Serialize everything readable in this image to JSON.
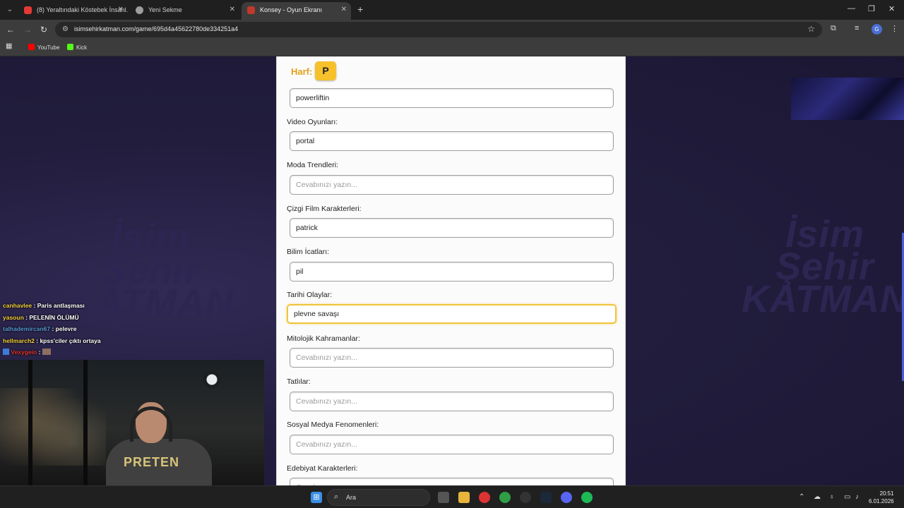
{
  "browser": {
    "tabs": [
      {
        "title": "(8) Yeraltındaki Köstebek İnsanl...",
        "favicon_color": "#e53935"
      },
      {
        "title": "Yeni Sekme",
        "favicon_color": "#9e9e9e"
      },
      {
        "title": "Konsey - Oyun Ekranı",
        "favicon_color": "#c0392b",
        "active": true
      }
    ],
    "url": "isimsehirkatman.com/game/695d4a45622780de334251a4",
    "bookmarks": [
      {
        "label": "YouTube",
        "color": "#ff0000"
      },
      {
        "label": "Kick",
        "color": "#53fc18"
      }
    ],
    "profile_initial": "G"
  },
  "game": {
    "letter_label": "Harf:",
    "letter": "P",
    "placeholder": "Cevabınızı yazın...",
    "fields": [
      {
        "label": "",
        "value": "powerliftin"
      },
      {
        "label": "Video Oyunları:",
        "value": "portal"
      },
      {
        "label": "Moda Trendleri:",
        "value": ""
      },
      {
        "label": "Çizgi Film Karakterleri:",
        "value": "patrick"
      },
      {
        "label": "Bilim İcatları:",
        "value": "pil"
      },
      {
        "label": "Tarihi Olaylar:",
        "value": "plevne savaşı",
        "focused": true
      },
      {
        "label": "Mitolojik Kahramanlar:",
        "value": ""
      },
      {
        "label": "Tatlılar:",
        "value": ""
      },
      {
        "label": "Sosyal Medya Fenomenleri:",
        "value": ""
      },
      {
        "label": "Edebiyat Karakterleri:",
        "value": ""
      }
    ],
    "watermark": "İsim\nŞehir\nKATMAN"
  },
  "stream": {
    "chat": [
      {
        "user": "canhavlee",
        "text": ": Paris antlaşması",
        "color": "#f5d142"
      },
      {
        "user": "yasoun",
        "text": ": PELENİN ÖLÜMÜ",
        "color": "#f5d142"
      },
      {
        "user": "talhademircan67",
        "text": ": pelevre",
        "color": "#5b9bd5"
      },
      {
        "user": "hellmarch2",
        "text": ": kpss'ciler çıktı ortaya",
        "color": "#f5d142"
      },
      {
        "user": "Vexygein",
        "text": ":",
        "color": "#e53935"
      }
    ],
    "shirt_text": "PRETEN"
  },
  "taskbar": {
    "search_label": "Ara",
    "time": "20:51",
    "date": "6.01.2026"
  }
}
